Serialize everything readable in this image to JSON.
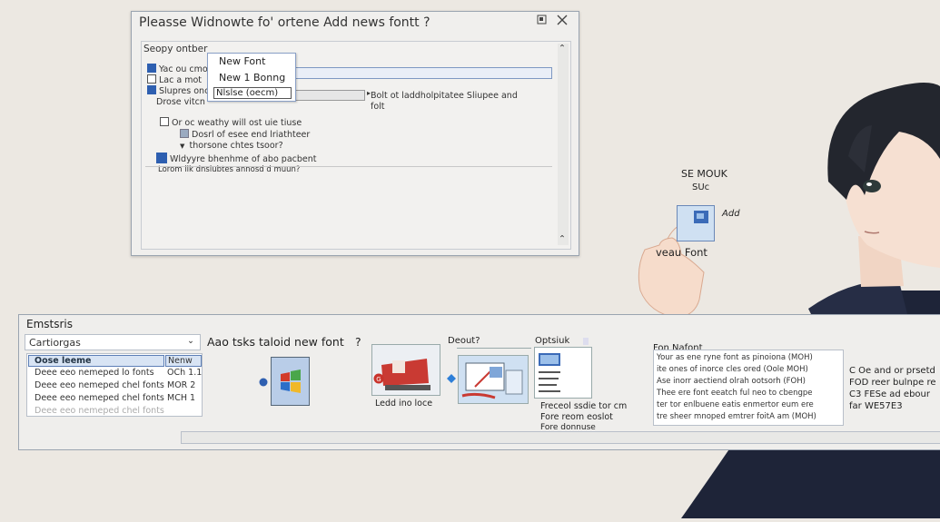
{
  "dialog": {
    "title": "Pleasse Widnowte fo' ortene Add news fontt ?",
    "maximize_icon": "maximize-icon",
    "close_icon": "close-icon",
    "section_label": "Seopy ontber",
    "rows": [
      {
        "label": "Yac ou cmo",
        "checked": true
      },
      {
        "label": "Lac a mot",
        "checked": false
      },
      {
        "label": "Slupres onc",
        "checked": true
      },
      {
        "label": "Drose vitcn",
        "checked": false
      }
    ],
    "sub_rows": [
      "Or oc weathy will ost uie tiuse",
      "Dosrl of esee end lriathteer",
      "thorsone chtes tsoor?",
      "Wldyyre bhenhme of abo pacbent",
      "Lorom lik dnslubtes annosd d muun?"
    ],
    "side_note_1": "Bolt ot laddholpitatee Sliupee and",
    "side_note_2": "folt",
    "dropdown": {
      "options": [
        "New Font",
        "New 1 Bonng"
      ],
      "selected": "Nlslse (oecm)"
    }
  },
  "figure": {
    "label_1": "SE MOUK",
    "label_2": "SUc",
    "card_caption": "Add",
    "card_sub": "veau Font"
  },
  "panel": {
    "title": "Emstsris",
    "category_select": "Cartiorgas",
    "list_header": "Oose leeme",
    "list_rows": [
      "Deee eeo nemeped lo fonts",
      "Deee eeo nemeped chel fonts",
      "Deee eeo nemeped chel fonts",
      "Deee eeo nemeped chel fonts"
    ],
    "list_col": [
      "Nenw",
      "OCh 1.1",
      "MOR 2",
      "MCH 1"
    ],
    "prompt": "Aao tsks taloid new font",
    "question_mark": "?",
    "thumb_caption": "Ledd ino loce",
    "detail_label": "Deout?",
    "detail_label2": "Optsiuk",
    "detail_caption_1": "Freceol ssdie tor cm",
    "detail_caption_2": "Fore reom eoslot",
    "detail_caption_3": "Fore donnuse",
    "info_title": "Fon Nafont",
    "info_lines": [
      "Your as ene ryne font as pinoiona (MOH)",
      "ite ones of inorce cles ored (Oole MOH)",
      "Ase inorr aectiend olrah ootsorh (FOH)",
      "Thee ere font eeatch ful neo to cbengpe",
      "ter tor enlbuene eatis enmertor eum ere",
      "tre sheer mnoped emtrer foitA am (MOH)"
    ],
    "side_text": [
      "C Oe and or prsetd",
      "FOD reer bulnpe re",
      "C3 FESe ad ebour",
      "far WE57E3"
    ]
  }
}
